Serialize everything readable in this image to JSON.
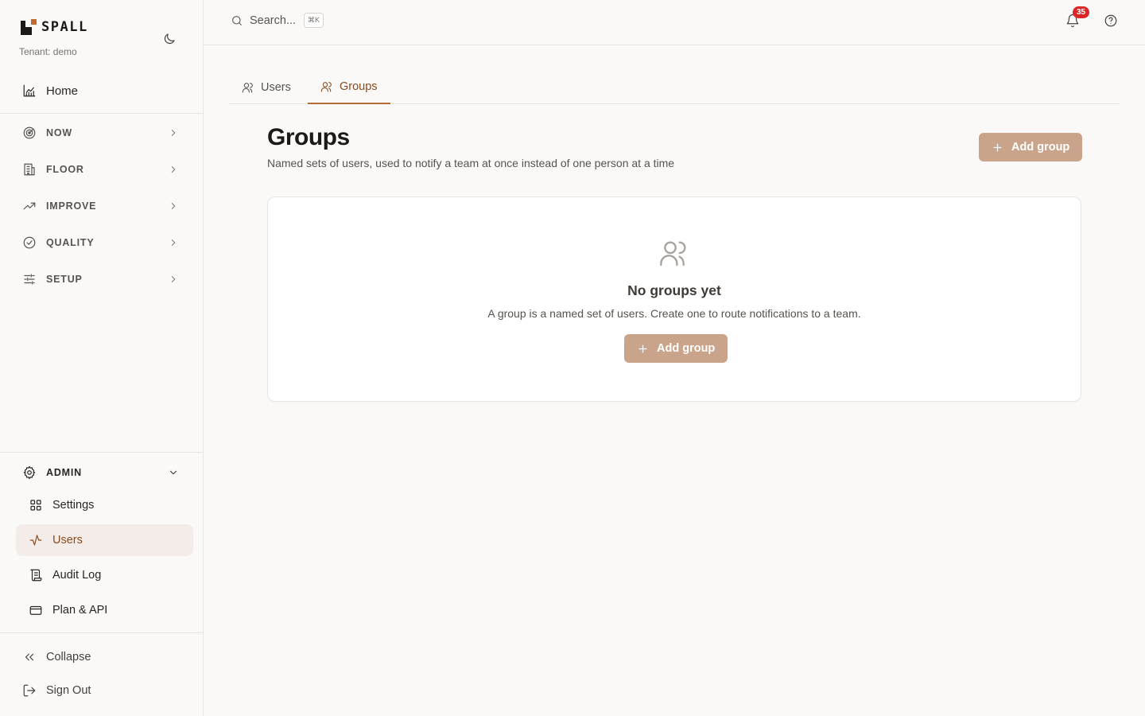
{
  "brand": {
    "name": "SPALL",
    "tenant": "Tenant: demo"
  },
  "sidebar": {
    "home": "Home",
    "sections": [
      {
        "label": "NOW",
        "icon": "radar-icon"
      },
      {
        "label": "FLOOR",
        "icon": "building-icon"
      },
      {
        "label": "IMPROVE",
        "icon": "trending-up-icon"
      },
      {
        "label": "QUALITY",
        "icon": "check-circle-icon"
      },
      {
        "label": "SETUP",
        "icon": "sliders-icon"
      }
    ],
    "admin": {
      "label": "ADMIN",
      "items": [
        {
          "label": "Settings",
          "icon": "grid-icon"
        },
        {
          "label": "Users",
          "icon": "activity-icon",
          "active": true
        },
        {
          "label": "Audit Log",
          "icon": "scroll-icon"
        },
        {
          "label": "Plan & API",
          "icon": "credit-card-icon"
        }
      ]
    },
    "footer": {
      "collapse": "Collapse",
      "sign_out": "Sign Out"
    }
  },
  "topbar": {
    "search_placeholder": "Search...",
    "shortcut": "⌘K",
    "notification_count": "35"
  },
  "tabs": [
    {
      "label": "Users",
      "active": false
    },
    {
      "label": "Groups",
      "active": true
    }
  ],
  "header": {
    "title": "Groups",
    "subtitle": "Named sets of users, used to notify a team at once instead of one person at a time",
    "add_button": "Add group"
  },
  "empty_state": {
    "title": "No groups yet",
    "description": "A group is a named set of users. Create one to route notifications to a team.",
    "add_button": "Add group"
  },
  "colors": {
    "accent": "#8a4a1f",
    "button": "#c9a48b",
    "active_bg": "#f3ece8",
    "badge": "#dc2626"
  }
}
